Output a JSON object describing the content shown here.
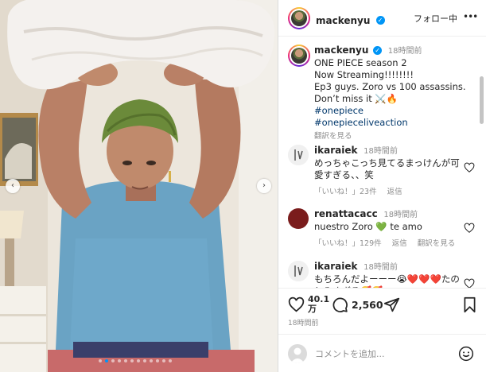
{
  "post": {
    "username": "mackenyu",
    "follow_label": "フォロー中",
    "more_label": "•••"
  },
  "caption": {
    "username": "mackenyu",
    "time": "18時間前",
    "lines": [
      "ONE PIECE season 2",
      "Now Streaming!!!!!!!!",
      "Ep3 guys. Zoro vs 100 assassins.",
      "Don’t miss it ⚔️🔥"
    ],
    "hashtags": [
      "#onepiece",
      "#onepieceliveaction"
    ],
    "translate_label": "翻訳を見る"
  },
  "comments": [
    {
      "username": "ikaraiek",
      "time": "18時間前",
      "text": "めっちゃこっち見てるまっけんが可愛すぎる、、笑",
      "likes": "「いいね！」23件",
      "reply": "返信",
      "translate": ""
    },
    {
      "username": "renattacacc",
      "time": "18時間前",
      "text": "nuestro Zoro 💚 te amo",
      "likes": "「いいね！」129件",
      "reply": "返信",
      "translate": "翻訳を見る"
    },
    {
      "username": "ikaraiek",
      "time": "18時間前",
      "text": "もちろんだよーーー😭❤️❤️❤️たのしみすぎる🥰🥰",
      "likes": "",
      "reply": "",
      "translate": ""
    }
  ],
  "actions": {
    "likes_line1": "40.1",
    "likes_line2": "万",
    "comment_count": "2,560",
    "post_time": "18時間前"
  },
  "comment_box": {
    "placeholder": "コメントを追加..."
  },
  "colors": {
    "link": "#00376b",
    "verified": "#0095f6",
    "muted": "#8e8e8e",
    "shirt": "#6aa3c4",
    "hair": "#6b8a3a"
  },
  "icons": {
    "heart": "heart-icon",
    "comment": "comment-icon",
    "share": "share-icon",
    "bookmark": "bookmark-icon",
    "emoji": "emoji-icon"
  }
}
